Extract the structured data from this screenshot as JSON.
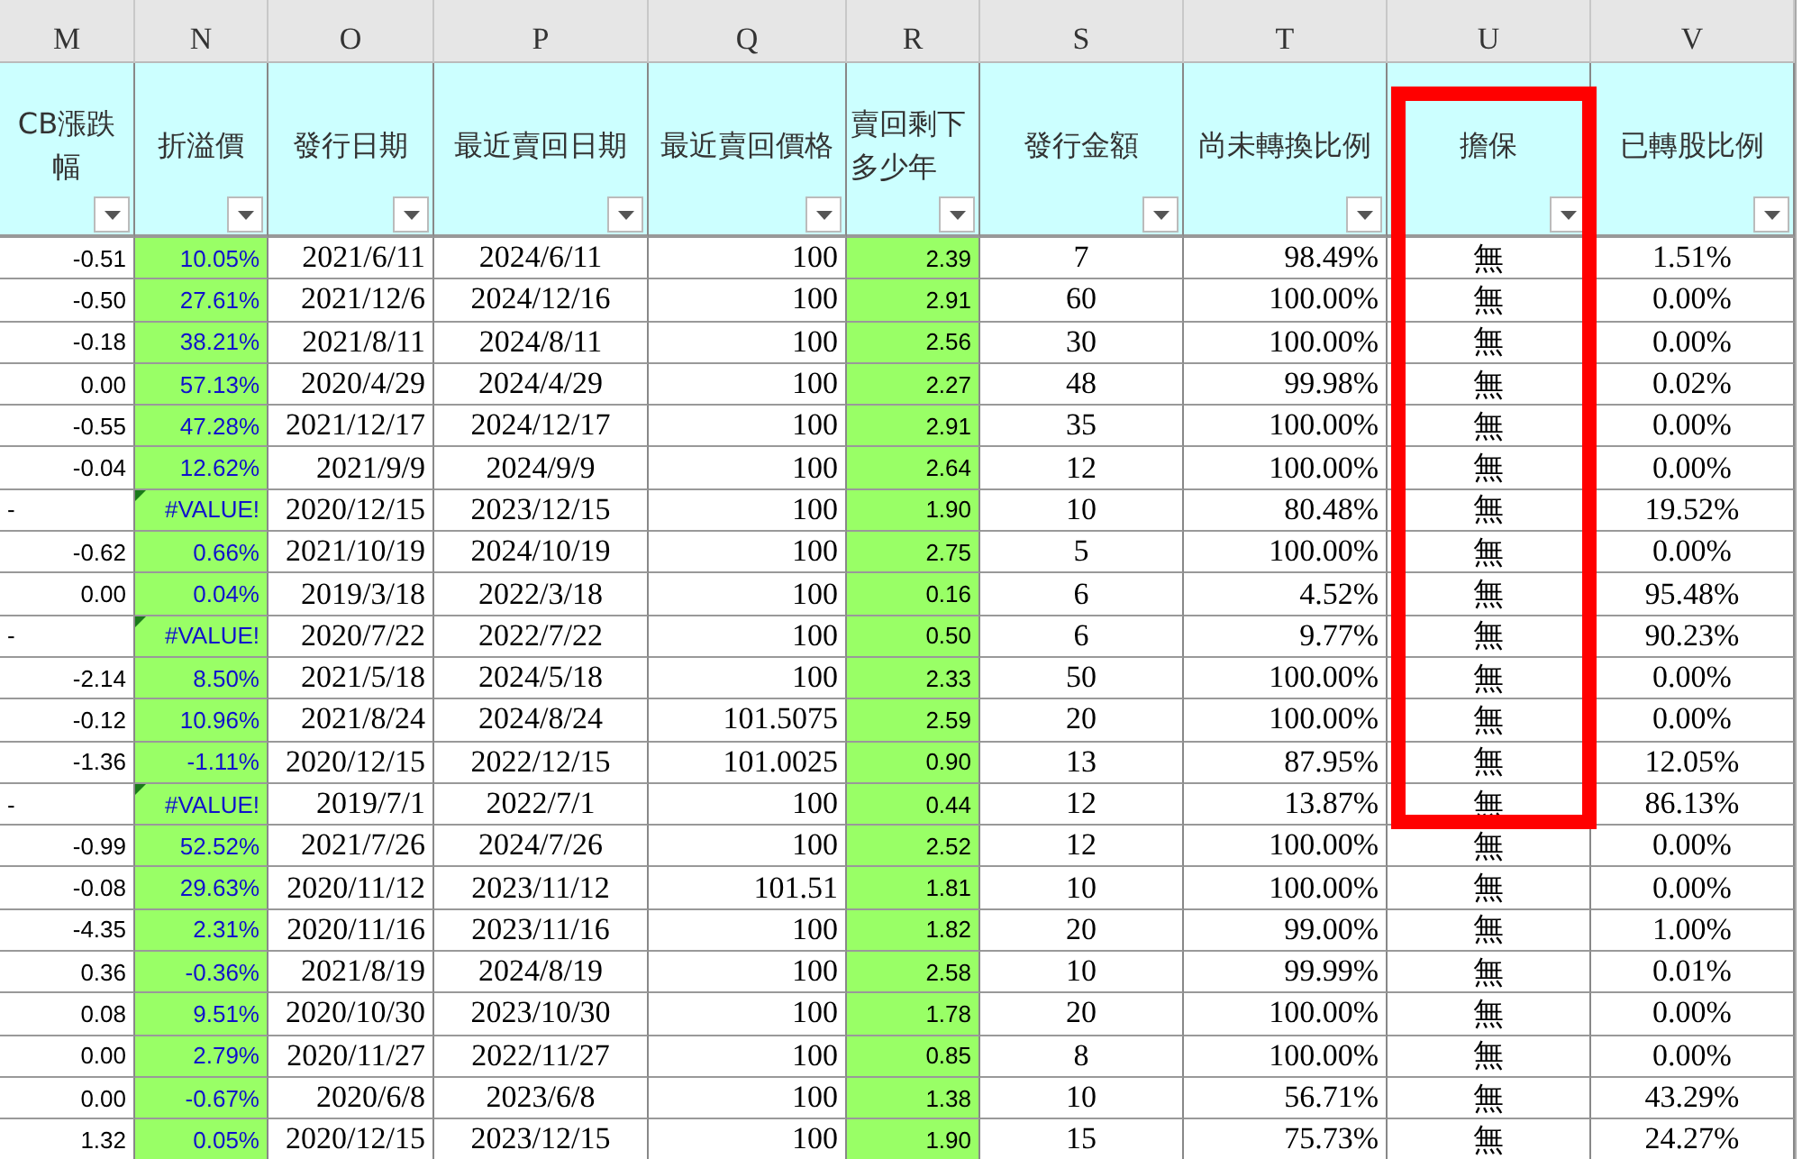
{
  "columns": [
    {
      "letter": "M",
      "header": "CB漲跌幅",
      "kind": "sans"
    },
    {
      "letter": "N",
      "header": "折溢價",
      "kind": "sans-green"
    },
    {
      "letter": "O",
      "header": "發行日期",
      "kind": "serif"
    },
    {
      "letter": "P",
      "header": "最近賣回日期",
      "kind": "serif"
    },
    {
      "letter": "Q",
      "header": "最近賣回價格",
      "kind": "serif"
    },
    {
      "letter": "R",
      "header": "賣回剩下多少年",
      "kind": "green"
    },
    {
      "letter": "S",
      "header": "發行金額",
      "kind": "serif"
    },
    {
      "letter": "T",
      "header": "尚未轉換比例",
      "kind": "serif"
    },
    {
      "letter": "U",
      "header": "擔保",
      "kind": "serif"
    },
    {
      "letter": "V",
      "header": "已轉股比例",
      "kind": "serif"
    }
  ],
  "rows": [
    {
      "warning": false,
      "cells": [
        "-0.51",
        "10.05%",
        "2021/6/11",
        "2024/6/11",
        "100",
        "2.39",
        "7",
        "98.49%",
        "無",
        "1.51%"
      ]
    },
    {
      "warning": false,
      "cells": [
        "-0.50",
        "27.61%",
        "2021/12/6",
        "2024/12/16",
        "100",
        "2.91",
        "60",
        "100.00%",
        "無",
        "0.00%"
      ]
    },
    {
      "warning": false,
      "cells": [
        "-0.18",
        "38.21%",
        "2021/8/11",
        "2024/8/11",
        "100",
        "2.56",
        "30",
        "100.00%",
        "無",
        "0.00%"
      ]
    },
    {
      "warning": false,
      "cells": [
        "0.00",
        "57.13%",
        "2020/4/29",
        "2024/4/29",
        "100",
        "2.27",
        "48",
        "99.98%",
        "無",
        "0.02%"
      ]
    },
    {
      "warning": false,
      "cells": [
        "-0.55",
        "47.28%",
        "2021/12/17",
        "2024/12/17",
        "100",
        "2.91",
        "35",
        "100.00%",
        "無",
        "0.00%"
      ]
    },
    {
      "warning": false,
      "cells": [
        "-0.04",
        "12.62%",
        "2021/9/9",
        "2024/9/9",
        "100",
        "2.64",
        "12",
        "100.00%",
        "無",
        "0.00%"
      ]
    },
    {
      "warning": true,
      "cells": [
        "-",
        "#VALUE!",
        "2020/12/15",
        "2023/12/15",
        "100",
        "1.90",
        "10",
        "80.48%",
        "無",
        "19.52%"
      ]
    },
    {
      "warning": false,
      "cells": [
        "-0.62",
        "0.66%",
        "2021/10/19",
        "2024/10/19",
        "100",
        "2.75",
        "5",
        "100.00%",
        "無",
        "0.00%"
      ]
    },
    {
      "warning": false,
      "cells": [
        "0.00",
        "0.04%",
        "2019/3/18",
        "2022/3/18",
        "100",
        "0.16",
        "6",
        "4.52%",
        "無",
        "95.48%"
      ]
    },
    {
      "warning": true,
      "cells": [
        "-",
        "#VALUE!",
        "2020/7/22",
        "2022/7/22",
        "100",
        "0.50",
        "6",
        "9.77%",
        "無",
        "90.23%"
      ]
    },
    {
      "warning": false,
      "cells": [
        "-2.14",
        "8.50%",
        "2021/5/18",
        "2024/5/18",
        "100",
        "2.33",
        "50",
        "100.00%",
        "無",
        "0.00%"
      ]
    },
    {
      "warning": false,
      "cells": [
        "-0.12",
        "10.96%",
        "2021/8/24",
        "2024/8/24",
        "101.5075",
        "2.59",
        "20",
        "100.00%",
        "無",
        "0.00%"
      ]
    },
    {
      "warning": false,
      "cells": [
        "-1.36",
        "-1.11%",
        "2020/12/15",
        "2022/12/15",
        "101.0025",
        "0.90",
        "13",
        "87.95%",
        "無",
        "12.05%"
      ]
    },
    {
      "warning": true,
      "cells": [
        "-",
        "#VALUE!",
        "2019/7/1",
        "2022/7/1",
        "100",
        "0.44",
        "12",
        "13.87%",
        "無",
        "86.13%"
      ]
    },
    {
      "warning": false,
      "cells": [
        "-0.99",
        "52.52%",
        "2021/7/26",
        "2024/7/26",
        "100",
        "2.52",
        "12",
        "100.00%",
        "無",
        "0.00%"
      ]
    },
    {
      "warning": false,
      "cells": [
        "-0.08",
        "29.63%",
        "2020/11/12",
        "2023/11/12",
        "101.51",
        "1.81",
        "10",
        "100.00%",
        "無",
        "0.00%"
      ]
    },
    {
      "warning": false,
      "cells": [
        "-4.35",
        "2.31%",
        "2020/11/16",
        "2023/11/16",
        "100",
        "1.82",
        "20",
        "99.00%",
        "無",
        "1.00%"
      ]
    },
    {
      "warning": false,
      "cells": [
        "0.36",
        "-0.36%",
        "2021/8/19",
        "2024/8/19",
        "100",
        "2.58",
        "10",
        "99.99%",
        "無",
        "0.01%"
      ]
    },
    {
      "warning": false,
      "cells": [
        "0.08",
        "9.51%",
        "2020/10/30",
        "2023/10/30",
        "100",
        "1.78",
        "20",
        "100.00%",
        "無",
        "0.00%"
      ]
    },
    {
      "warning": false,
      "cells": [
        "0.00",
        "2.79%",
        "2020/11/27",
        "2022/11/27",
        "100",
        "0.85",
        "8",
        "100.00%",
        "無",
        "0.00%"
      ]
    },
    {
      "warning": false,
      "cells": [
        "0.00",
        "-0.67%",
        "2020/6/8",
        "2023/6/8",
        "100",
        "1.38",
        "10",
        "56.71%",
        "無",
        "43.29%"
      ]
    },
    {
      "warning": false,
      "cells": [
        "1.32",
        "0.05%",
        "2020/12/15",
        "2023/12/15",
        "100",
        "1.90",
        "15",
        "75.73%",
        "無",
        "24.27%"
      ]
    }
  ]
}
